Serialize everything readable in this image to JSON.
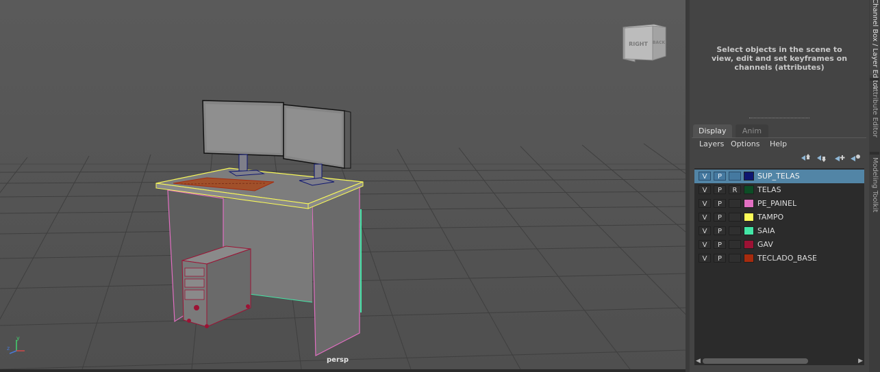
{
  "viewport": {
    "camera_label": "persp",
    "view_cube": {
      "face_front": "RIGHT",
      "face_side": "BACK"
    },
    "axis": {
      "y": "y",
      "z": "z"
    }
  },
  "channel_box": {
    "message": "Select objects in the scene to view, edit and set keyframes on channels (attributes)"
  },
  "layer_editor": {
    "tabs": [
      {
        "label": "Display",
        "active": true
      },
      {
        "label": "Anim",
        "active": false
      }
    ],
    "menu": [
      "Layers",
      "Options",
      "Help"
    ],
    "toolbar_icons": [
      "move-layer-up-icon",
      "move-layer-down-icon",
      "new-layer-from-selected-icon",
      "new-empty-layer-icon"
    ],
    "layers": [
      {
        "v": "V",
        "p": "P",
        "r": "",
        "name": "SUP_TELAS",
        "color": "#0e1670",
        "selected": true
      },
      {
        "v": "V",
        "p": "P",
        "r": "R",
        "name": "TELAS",
        "color": "#0d4d26",
        "selected": false
      },
      {
        "v": "V",
        "p": "P",
        "r": "",
        "name": "PE_PAINEL",
        "color": "#e26fc2",
        "selected": false
      },
      {
        "v": "V",
        "p": "P",
        "r": "",
        "name": "TAMPO",
        "color": "#fbfb58",
        "selected": false
      },
      {
        "v": "V",
        "p": "P",
        "r": "",
        "name": "SAIA",
        "color": "#43e6a6",
        "selected": false
      },
      {
        "v": "V",
        "p": "P",
        "r": "",
        "name": "GAV",
        "color": "#9c1234",
        "selected": false
      },
      {
        "v": "V",
        "p": "P",
        "r": "",
        "name": "TECLADO_BASE",
        "color": "#a72b0e",
        "selected": false
      }
    ]
  },
  "side_tabs": [
    "Channel Box / Layer Editor",
    "Attribute Editor",
    "Modeling Toolkit"
  ]
}
